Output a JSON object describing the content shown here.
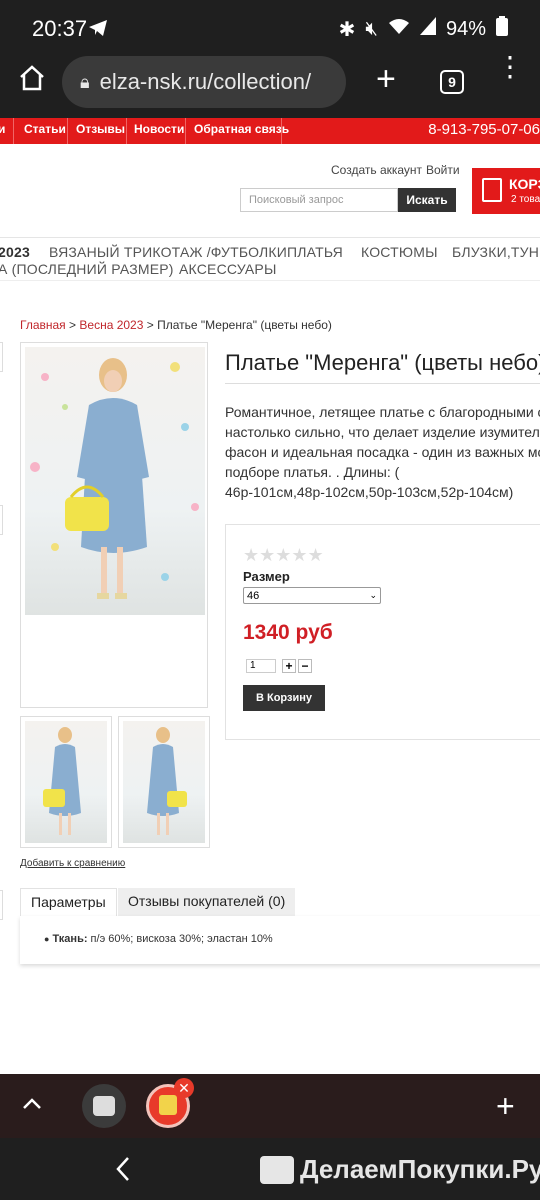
{
  "status": {
    "time": "20:37",
    "battery": "94%",
    "icons": [
      "telegram-icon",
      "bluetooth-icon",
      "mute-icon",
      "wifi-icon",
      "signal-icon",
      "battery-icon"
    ]
  },
  "browser": {
    "url": "elza-nsk.ru/collection/",
    "tab_count": "9"
  },
  "site_nav": {
    "items": [
      "и",
      "Статьи",
      "Отзывы",
      "Новости",
      "Обратная связь"
    ],
    "phone": "8-913-795-07-06"
  },
  "header": {
    "create_account": "Создать аккаунт",
    "login": "Войти",
    "search_placeholder": "Поисковый запрос",
    "search_button": "Искать",
    "cart_title": "КОРЗ",
    "cart_sub": "2 това"
  },
  "catalog_menu": {
    "row1": [
      "2023",
      "ВЯЗАНЫЙ ТРИКОТАЖ /ФУТБОЛКИ",
      "ПЛАТЬЯ",
      "КОСТЮМЫ",
      "БЛУЗКИ,ТУНИ"
    ],
    "row2": [
      "А (ПОСЛЕДНИЙ РАЗМЕР)",
      "АКСЕССУАРЫ"
    ]
  },
  "breadcrumb": {
    "home": "Главная",
    "sep": ">",
    "section": "Весна 2023",
    "current": "Платье \"Меренга\" (цветы небо)"
  },
  "product": {
    "title": "Платье \"Меренга\" (цветы небо)",
    "description": [
      "Романтичное, летящее платье с благородными от",
      "настолько сильно, что делает изделие изумитель",
      "фасон и идеальная посадка - один из важных мом",
      "подборе платья. . Длины: (",
      "46р-101см,48р-102см,50р-103см,52р-104см)"
    ],
    "rating_stars": "★★★★★",
    "size_label": "Размер",
    "size_selected": "46",
    "price": "1340 руб",
    "quantity": "1",
    "add_to_cart": "В Корзину",
    "compare": "Добавить к сравнению"
  },
  "tabs": {
    "params": "Параметры",
    "reviews": "Отзывы покупателей (0)",
    "spec_label": "Ткань:",
    "spec_value": " п/э 60%; вискоза 30%; эластан 10%"
  },
  "watermark": "ДелаемПокупки.Ру",
  "colors": {
    "brand_red": "#e21a1a",
    "price_red": "#d01f25",
    "link_red": "#c0262b"
  }
}
